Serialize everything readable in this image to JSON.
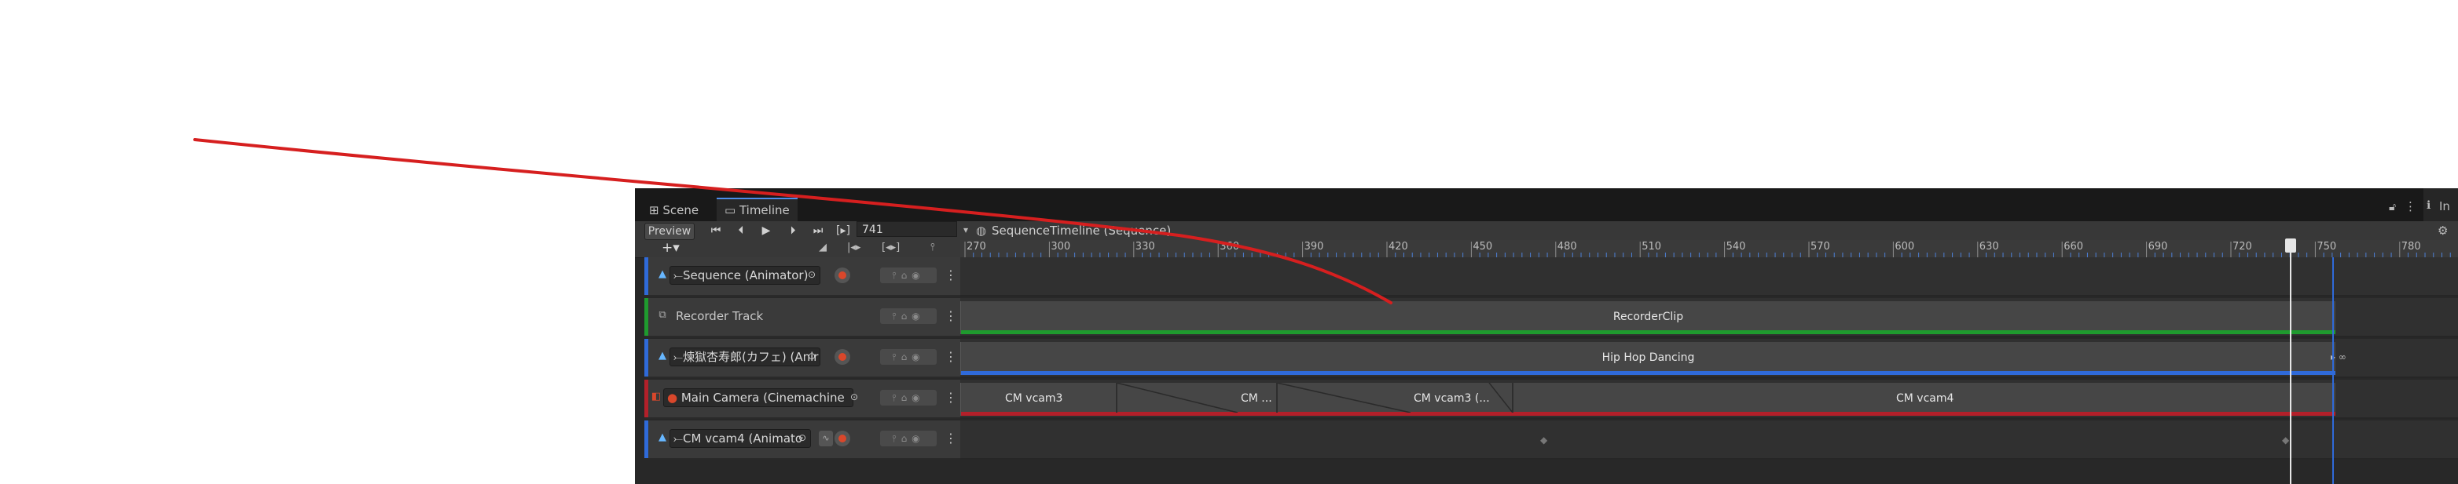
{
  "tabs": {
    "scene": "Scene",
    "timeline": "Timeline"
  },
  "toolbar": {
    "preview": "Preview",
    "frame": "741"
  },
  "breadcrumb": "SequenceTimeline (Sequence)",
  "ruler": {
    "ticks": [
      "270",
      "300",
      "330",
      "360",
      "390",
      "420",
      "450",
      "480",
      "510",
      "540",
      "570",
      "600",
      "630",
      "660",
      "690",
      "720",
      "750",
      "780"
    ]
  },
  "tracks": [
    {
      "label": "Sequence (Animator)",
      "color": "#2f6ad9"
    },
    {
      "label": "Recorder Track",
      "color": "#1f9a2e"
    },
    {
      "label": "煉獄杏寿郎(カフェ) (Anir",
      "color": "#2f6ad9"
    },
    {
      "label": "Main Camera (Cinemachine",
      "color": "#b3202a"
    },
    {
      "label": "CM vcam4 (Animato",
      "color": "#2f6ad9"
    }
  ],
  "clips": {
    "recorder": "RecorderClip",
    "hiphop": "Hip Hop Dancing",
    "cam1": "CM vcam3",
    "cam2": "CM ...",
    "cam3": "CM vcam3 (...",
    "cam4": "CM vcam4"
  },
  "right_panel": {
    "label": "In"
  }
}
